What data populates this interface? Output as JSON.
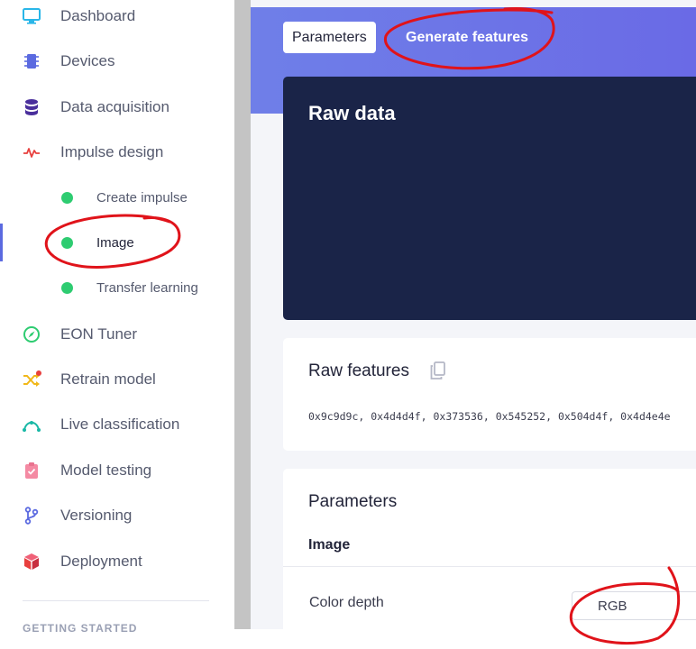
{
  "sidebar": {
    "items": [
      {
        "label": "Dashboard",
        "icon": "monitor-icon"
      },
      {
        "label": "Devices",
        "icon": "chip-icon"
      },
      {
        "label": "Data acquisition",
        "icon": "database-icon"
      },
      {
        "label": "Impulse design",
        "icon": "pulse-icon"
      },
      {
        "label": "EON Tuner",
        "icon": "compass-icon"
      },
      {
        "label": "Retrain model",
        "icon": "shuffle-icon"
      },
      {
        "label": "Live classification",
        "icon": "signal-icon"
      },
      {
        "label": "Model testing",
        "icon": "clipboard-check-icon"
      },
      {
        "label": "Versioning",
        "icon": "git-branch-icon"
      },
      {
        "label": "Deployment",
        "icon": "cube-icon"
      }
    ],
    "sub_items": [
      {
        "label": "Create impulse"
      },
      {
        "label": "Image"
      },
      {
        "label": "Transfer learning"
      }
    ],
    "section_heading": "GETTING STARTED"
  },
  "tabs": {
    "parameters": "Parameters",
    "generate_features": "Generate features"
  },
  "raw_data": {
    "title": "Raw data"
  },
  "raw_features": {
    "title": "Raw features",
    "values": "0x9c9d9c, 0x4d4d4f, 0x373536, 0x545252, 0x504d4f, 0x4d4e4e"
  },
  "parameters": {
    "title": "Parameters",
    "section": "Image",
    "color_depth_label": "Color depth",
    "color_depth_value": "RGB"
  },
  "colors": {
    "accent": "#6a6ae6",
    "dark_card": "#1a2448",
    "active_dot": "#2ecc71",
    "annotation": "#e0131a"
  }
}
